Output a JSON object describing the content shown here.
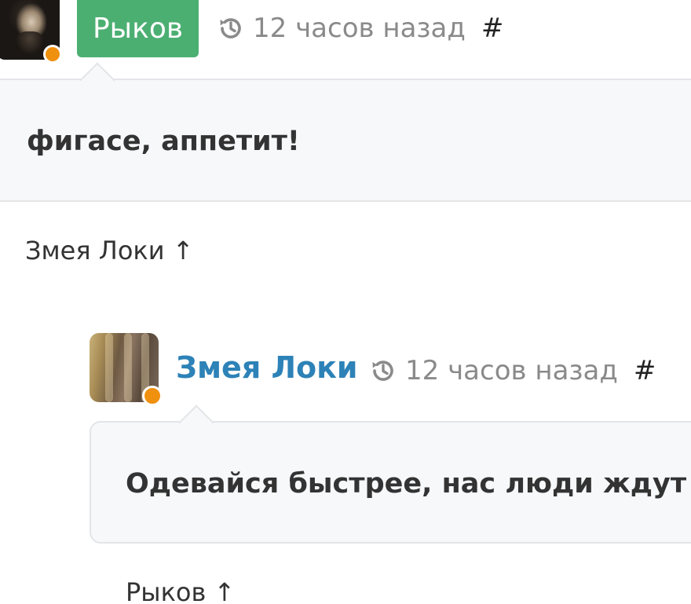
{
  "comments": [
    {
      "author": "Рыков",
      "time": "12 часов назад",
      "permalink": "#",
      "text": "фигасе, аппетит!",
      "reply_to": "Змея Локи ↑",
      "status_color": "#f0900f",
      "badge_color": "#4caf72"
    },
    {
      "author": "Змея Локи",
      "time": "12 часов назад",
      "permalink": "#",
      "text": "Одевайся быстрее, нас люди ждут",
      "reply_to": "Рыков ↑",
      "status_color": "#f0900f",
      "author_color": "#2d82b7"
    }
  ],
  "icons": {
    "time": "history-icon",
    "avatar_status": "online-status-dot"
  }
}
